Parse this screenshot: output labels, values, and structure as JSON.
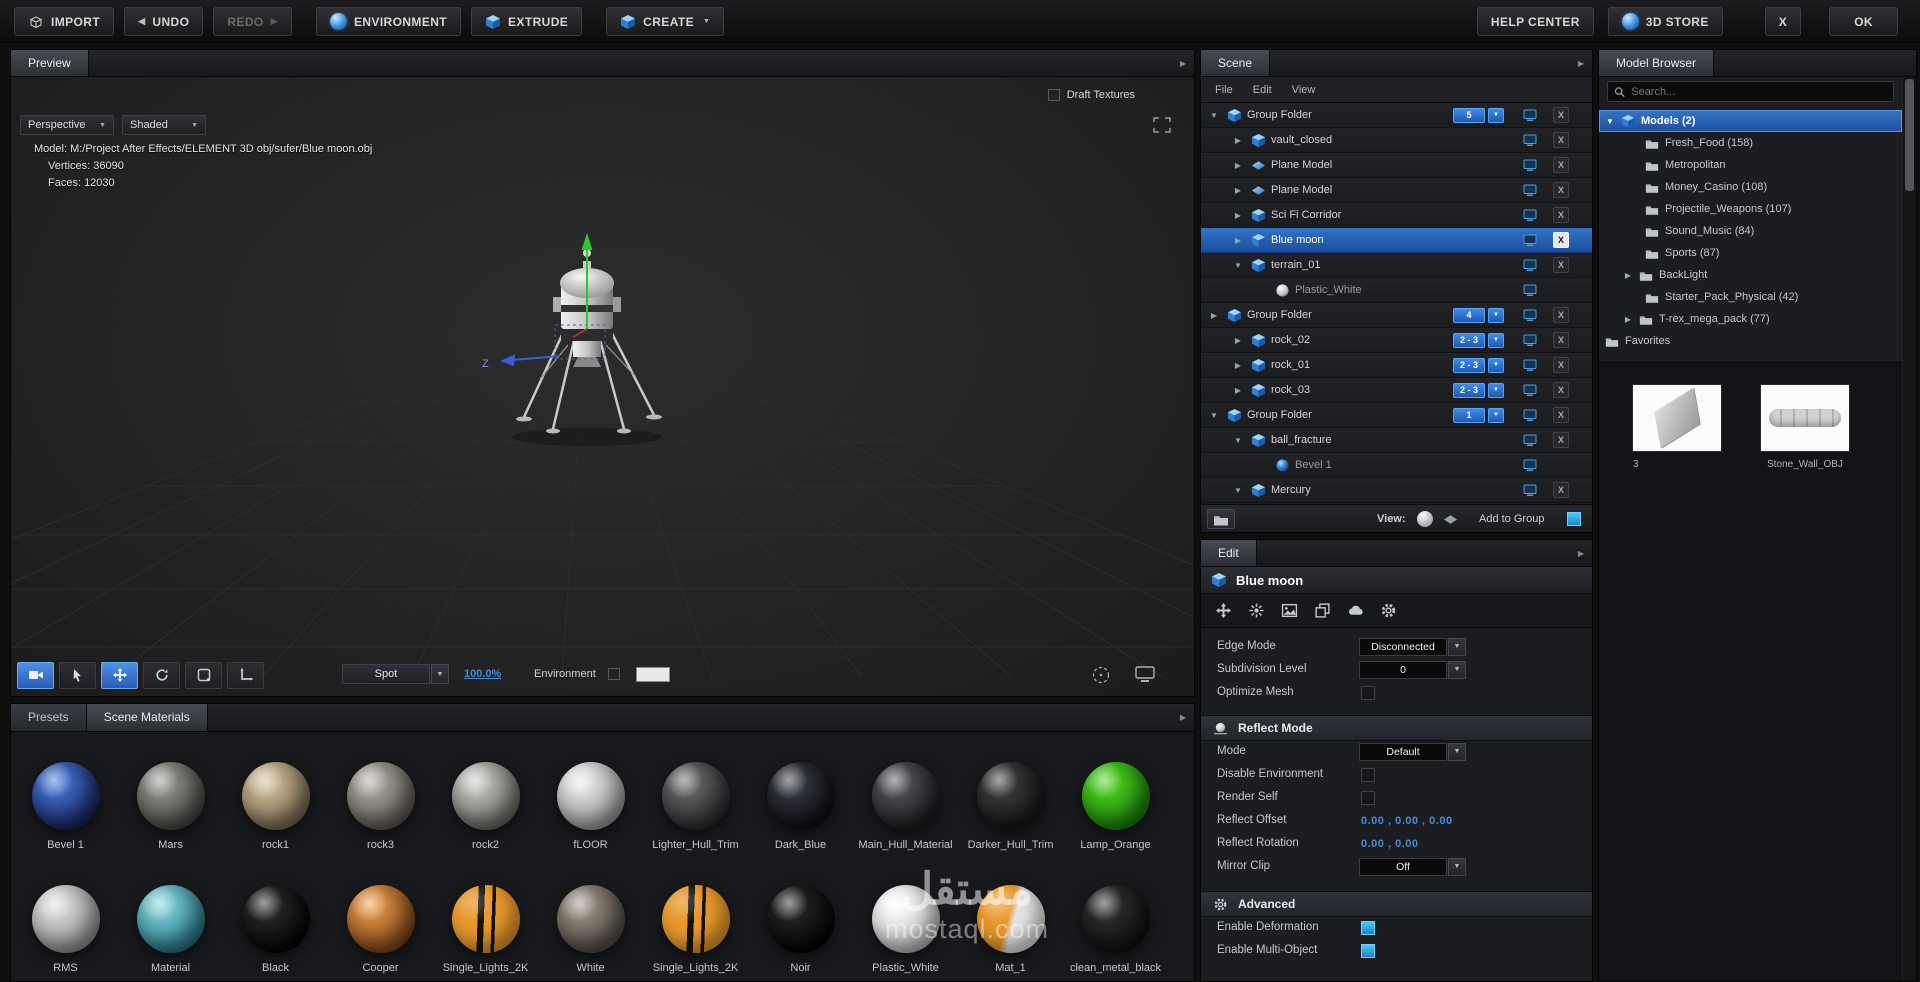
{
  "toolbar": {
    "import": "IMPORT",
    "undo": "UNDO",
    "redo": "REDO",
    "environment": "ENVIRONMENT",
    "extrude": "EXTRUDE",
    "create": "CREATE",
    "help_center": "HELP CENTER",
    "store": "3D STORE",
    "close": "X",
    "ok": "OK"
  },
  "preview": {
    "tab": "Preview",
    "draft_textures_label": "Draft Textures",
    "view_mode": "Perspective",
    "shade_mode": "Shaded",
    "model_path_label": "Model:  M:/Project After Effects/ELEMENT 3D obj/sufer/Blue moon.obj",
    "vertices_label": "Vertices:  36090",
    "faces_label": "Faces:  12030",
    "axis_label": "Z",
    "footer": {
      "light_select": "Spot",
      "zoom": "100.0%",
      "environment_label": "Environment"
    }
  },
  "materials": {
    "tabs": {
      "presets": "Presets",
      "scene_materials": "Scene Materials"
    },
    "row1": [
      {
        "name": "Bevel 1",
        "c1": "#4a7de0",
        "c2": "#101c4e"
      },
      {
        "name": "Mars",
        "c1": "#9c9c98",
        "c2": "#3c3c38"
      },
      {
        "name": "rock1",
        "c1": "#d8c4a2",
        "c2": "#6e5f46"
      },
      {
        "name": "rock3",
        "c1": "#b4b0a8",
        "c2": "#504d47"
      },
      {
        "name": "rock2",
        "c1": "#cccdc8",
        "c2": "#5c5c58"
      },
      {
        "name": "fLOOR",
        "c1": "#ececec",
        "c2": "#8e8e8e"
      },
      {
        "name": "Lighter_Hull_Trim",
        "c1": "#6e6e70",
        "c2": "#242426"
      },
      {
        "name": "Dark_Blue",
        "c1": "#3a3e46",
        "c2": "#0a0b0f"
      },
      {
        "name": "Main_Hull_Material",
        "c1": "#585a5e",
        "c2": "#17181a"
      },
      {
        "name": "Darker_Hull_Trim",
        "c1": "#424242",
        "c2": "#111111"
      },
      {
        "name": "Lamp_Orange",
        "c1": "#52d822",
        "c2": "#157506"
      }
    ],
    "row2": [
      {
        "name": "RMS",
        "c1": "#e2e2e2",
        "c2": "#868686"
      },
      {
        "name": "Material",
        "c1": "#8ad8de",
        "c2": "#1c6a7a"
      },
      {
        "name": "Black",
        "c1": "#303030",
        "c2": "#000000"
      },
      {
        "name": "Cooper",
        "c1": "#eda04e",
        "c2": "#743a10"
      },
      {
        "name": "Single_Lights_2K",
        "style": "wedge"
      },
      {
        "name": "White",
        "c1": "#a09788",
        "c2": "#46403a"
      },
      {
        "name": "Single_Lights_2K",
        "style": "wedge"
      },
      {
        "name": "Noir",
        "c1": "#2c2c2c",
        "c2": "#000000"
      },
      {
        "name": "Plastic_White",
        "c1": "#ffffff",
        "c2": "#b0b0b0"
      },
      {
        "name": "Mat_1",
        "style": "split"
      },
      {
        "name": "clean_metal_black",
        "c1": "#343434",
        "c2": "#0c0c0c"
      }
    ]
  },
  "watermark": {
    "line1": "مستقل",
    "line2": "mostaql.com"
  },
  "scene": {
    "tab": "Scene",
    "menu": [
      "File",
      "Edit",
      "View"
    ],
    "close_glyph": "X",
    "rows": [
      {
        "label": "Group Folder",
        "icon": "cube",
        "indent": 0,
        "arrow": "down",
        "badge": "5",
        "monitor": true,
        "close": true
      },
      {
        "label": "vault_closed",
        "icon": "cube",
        "indent": 1,
        "arrow": "right",
        "monitor": true,
        "close": true
      },
      {
        "label": "Plane Model",
        "icon": "plane",
        "indent": 1,
        "arrow": "right",
        "monitor": true,
        "close": true
      },
      {
        "label": "Plane Model",
        "icon": "plane",
        "indent": 1,
        "arrow": "right",
        "monitor": true,
        "close": true
      },
      {
        "label": "Sci Fi Corridor",
        "icon": "cube",
        "indent": 1,
        "arrow": "right",
        "monitor": true,
        "close": true
      },
      {
        "label": "Blue moon",
        "icon": "cube",
        "indent": 1,
        "arrow": "right",
        "monitor": true,
        "close": true,
        "selected": true
      },
      {
        "label": "terrain_01",
        "icon": "cube",
        "indent": 1,
        "arrow": "down",
        "monitor": true,
        "close": true
      },
      {
        "label": "Plastic_White",
        "icon": "sphwhite",
        "indent": 2,
        "material": true,
        "monitor": true
      },
      {
        "label": "Group Folder",
        "icon": "cube",
        "indent": 0,
        "arrow": "right",
        "badge": "4",
        "monitor": true,
        "close": true
      },
      {
        "label": "rock_02",
        "icon": "cube",
        "indent": 1,
        "arrow": "right",
        "badge": "2 - 3",
        "monitor": true,
        "close": true
      },
      {
        "label": "rock_01",
        "icon": "cube",
        "indent": 1,
        "arrow": "right",
        "badge": "2 - 3",
        "monitor": true,
        "close": true
      },
      {
        "label": "rock_03",
        "icon": "cube",
        "indent": 1,
        "arrow": "right",
        "badge": "2 - 3",
        "monitor": true,
        "close": true
      },
      {
        "label": "Group Folder",
        "icon": "cube",
        "indent": 0,
        "arrow": "down",
        "badge": "1",
        "monitor": true,
        "close": true
      },
      {
        "label": "ball_fracture",
        "icon": "cube",
        "indent": 1,
        "arrow": "down",
        "monitor": true,
        "close": true
      },
      {
        "label": "Bevel 1",
        "icon": "sphblue",
        "indent": 2,
        "material": true,
        "monitor": true
      },
      {
        "label": "Mercury",
        "icon": "cube",
        "indent": 1,
        "arrow": "down",
        "monitor": true,
        "close": true
      }
    ],
    "footer": {
      "view_label": "View:",
      "add_to_group": "Add to Group"
    }
  },
  "edit": {
    "tab": "Edit",
    "object_name": "Blue moon",
    "edge_mode_label": "Edge Mode",
    "edge_mode_value": "Disconnected",
    "subdivision_label": "Subdivision Level",
    "subdivision_value": "0",
    "optimize_label": "Optimize Mesh",
    "reflect_section": "Reflect Mode",
    "mode_label": "Mode",
    "mode_value": "Default",
    "disable_env_label": "Disable Environment",
    "render_self_label": "Render Self",
    "reflect_offset_label": "Reflect Offset",
    "reflect_offset_value": "0.00 ,   0.00 ,   0.00",
    "reflect_rotation_label": "Reflect Rotation",
    "reflect_rotation_value": "0.00 ,   0.00",
    "mirror_clip_label": "Mirror Clip",
    "mirror_clip_value": "Off",
    "advanced_section": "Advanced",
    "enable_deform_label": "Enable Deformation",
    "enable_multi_label": "Enable Multi-Object"
  },
  "model_browser": {
    "tab": "Model Browser",
    "search_placeholder": "Search...",
    "rows": [
      {
        "label": "Models (2)",
        "icon": "cube",
        "indent": 0,
        "arrow": "down",
        "selected": true
      },
      {
        "label": "Fresh_Food (158)",
        "icon": "folder",
        "indent": 2
      },
      {
        "label": "Metropolitan",
        "icon": "folder",
        "indent": 2
      },
      {
        "label": "Money_Casino (108)",
        "icon": "folder",
        "indent": 2
      },
      {
        "label": "Projectile_Weapons (107)",
        "icon": "folder",
        "indent": 2
      },
      {
        "label": "Sound_Music (84)",
        "icon": "folder",
        "indent": 2
      },
      {
        "label": "Sports (87)",
        "icon": "folder",
        "indent": 2
      },
      {
        "label": "BackLight",
        "icon": "folder",
        "indent": 1,
        "arrow": "right"
      },
      {
        "label": "Starter_Pack_Physical (42)",
        "icon": "folder",
        "indent": 2
      },
      {
        "label": "T-rex_mega_pack (77)",
        "icon": "folder",
        "indent": 1,
        "arrow": "right"
      },
      {
        "label": "Favorites",
        "icon": "folder",
        "indent": 0
      }
    ],
    "thumbnails": [
      {
        "label": "3"
      },
      {
        "label": "Stone_Wall_OBJ"
      }
    ]
  }
}
